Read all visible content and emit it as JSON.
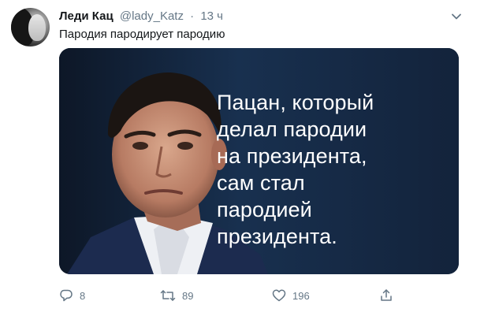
{
  "tweet": {
    "display_name": "Леди Кац",
    "handle": "@lady_Katz",
    "separator": "·",
    "time": "13 ч",
    "text": "Пародия пародирует пародию"
  },
  "media": {
    "lines": [
      "Пацан, который",
      "делал пародии",
      "на президента,",
      "сам стал",
      "пародией",
      "президента."
    ]
  },
  "actions": {
    "reply_count": "8",
    "retweet_count": "89",
    "like_count": "196"
  },
  "icons": {
    "reply": "reply-icon",
    "retweet": "retweet-icon",
    "like": "heart-icon",
    "share": "share-icon",
    "menu": "chevron-down-icon"
  },
  "colors": {
    "text": "#14171a",
    "secondary": "#657786",
    "media_background": "#15243a"
  }
}
